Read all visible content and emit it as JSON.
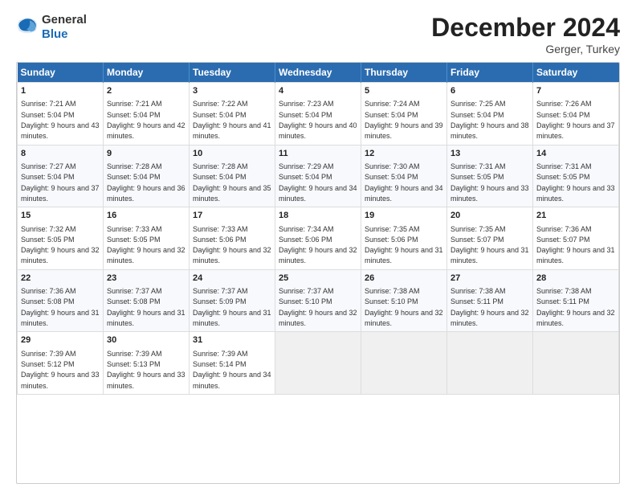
{
  "logo": {
    "text_general": "General",
    "text_blue": "Blue"
  },
  "title": {
    "month_year": "December 2024",
    "location": "Gerger, Turkey"
  },
  "headers": [
    "Sunday",
    "Monday",
    "Tuesday",
    "Wednesday",
    "Thursday",
    "Friday",
    "Saturday"
  ],
  "weeks": [
    [
      {
        "day": "1",
        "sunrise": "7:21 AM",
        "sunset": "5:04 PM",
        "daylight": "9 hours and 43 minutes."
      },
      {
        "day": "2",
        "sunrise": "7:21 AM",
        "sunset": "5:04 PM",
        "daylight": "9 hours and 42 minutes."
      },
      {
        "day": "3",
        "sunrise": "7:22 AM",
        "sunset": "5:04 PM",
        "daylight": "9 hours and 41 minutes."
      },
      {
        "day": "4",
        "sunrise": "7:23 AM",
        "sunset": "5:04 PM",
        "daylight": "9 hours and 40 minutes."
      },
      {
        "day": "5",
        "sunrise": "7:24 AM",
        "sunset": "5:04 PM",
        "daylight": "9 hours and 39 minutes."
      },
      {
        "day": "6",
        "sunrise": "7:25 AM",
        "sunset": "5:04 PM",
        "daylight": "9 hours and 38 minutes."
      },
      {
        "day": "7",
        "sunrise": "7:26 AM",
        "sunset": "5:04 PM",
        "daylight": "9 hours and 37 minutes."
      }
    ],
    [
      {
        "day": "8",
        "sunrise": "7:27 AM",
        "sunset": "5:04 PM",
        "daylight": "9 hours and 37 minutes."
      },
      {
        "day": "9",
        "sunrise": "7:28 AM",
        "sunset": "5:04 PM",
        "daylight": "9 hours and 36 minutes."
      },
      {
        "day": "10",
        "sunrise": "7:28 AM",
        "sunset": "5:04 PM",
        "daylight": "9 hours and 35 minutes."
      },
      {
        "day": "11",
        "sunrise": "7:29 AM",
        "sunset": "5:04 PM",
        "daylight": "9 hours and 34 minutes."
      },
      {
        "day": "12",
        "sunrise": "7:30 AM",
        "sunset": "5:04 PM",
        "daylight": "9 hours and 34 minutes."
      },
      {
        "day": "13",
        "sunrise": "7:31 AM",
        "sunset": "5:05 PM",
        "daylight": "9 hours and 33 minutes."
      },
      {
        "day": "14",
        "sunrise": "7:31 AM",
        "sunset": "5:05 PM",
        "daylight": "9 hours and 33 minutes."
      }
    ],
    [
      {
        "day": "15",
        "sunrise": "7:32 AM",
        "sunset": "5:05 PM",
        "daylight": "9 hours and 32 minutes."
      },
      {
        "day": "16",
        "sunrise": "7:33 AM",
        "sunset": "5:05 PM",
        "daylight": "9 hours and 32 minutes."
      },
      {
        "day": "17",
        "sunrise": "7:33 AM",
        "sunset": "5:06 PM",
        "daylight": "9 hours and 32 minutes."
      },
      {
        "day": "18",
        "sunrise": "7:34 AM",
        "sunset": "5:06 PM",
        "daylight": "9 hours and 32 minutes."
      },
      {
        "day": "19",
        "sunrise": "7:35 AM",
        "sunset": "5:06 PM",
        "daylight": "9 hours and 31 minutes."
      },
      {
        "day": "20",
        "sunrise": "7:35 AM",
        "sunset": "5:07 PM",
        "daylight": "9 hours and 31 minutes."
      },
      {
        "day": "21",
        "sunrise": "7:36 AM",
        "sunset": "5:07 PM",
        "daylight": "9 hours and 31 minutes."
      }
    ],
    [
      {
        "day": "22",
        "sunrise": "7:36 AM",
        "sunset": "5:08 PM",
        "daylight": "9 hours and 31 minutes."
      },
      {
        "day": "23",
        "sunrise": "7:37 AM",
        "sunset": "5:08 PM",
        "daylight": "9 hours and 31 minutes."
      },
      {
        "day": "24",
        "sunrise": "7:37 AM",
        "sunset": "5:09 PM",
        "daylight": "9 hours and 31 minutes."
      },
      {
        "day": "25",
        "sunrise": "7:37 AM",
        "sunset": "5:10 PM",
        "daylight": "9 hours and 32 minutes."
      },
      {
        "day": "26",
        "sunrise": "7:38 AM",
        "sunset": "5:10 PM",
        "daylight": "9 hours and 32 minutes."
      },
      {
        "day": "27",
        "sunrise": "7:38 AM",
        "sunset": "5:11 PM",
        "daylight": "9 hours and 32 minutes."
      },
      {
        "day": "28",
        "sunrise": "7:38 AM",
        "sunset": "5:11 PM",
        "daylight": "9 hours and 32 minutes."
      }
    ],
    [
      {
        "day": "29",
        "sunrise": "7:39 AM",
        "sunset": "5:12 PM",
        "daylight": "9 hours and 33 minutes."
      },
      {
        "day": "30",
        "sunrise": "7:39 AM",
        "sunset": "5:13 PM",
        "daylight": "9 hours and 33 minutes."
      },
      {
        "day": "31",
        "sunrise": "7:39 AM",
        "sunset": "5:14 PM",
        "daylight": "9 hours and 34 minutes."
      },
      null,
      null,
      null,
      null
    ]
  ]
}
